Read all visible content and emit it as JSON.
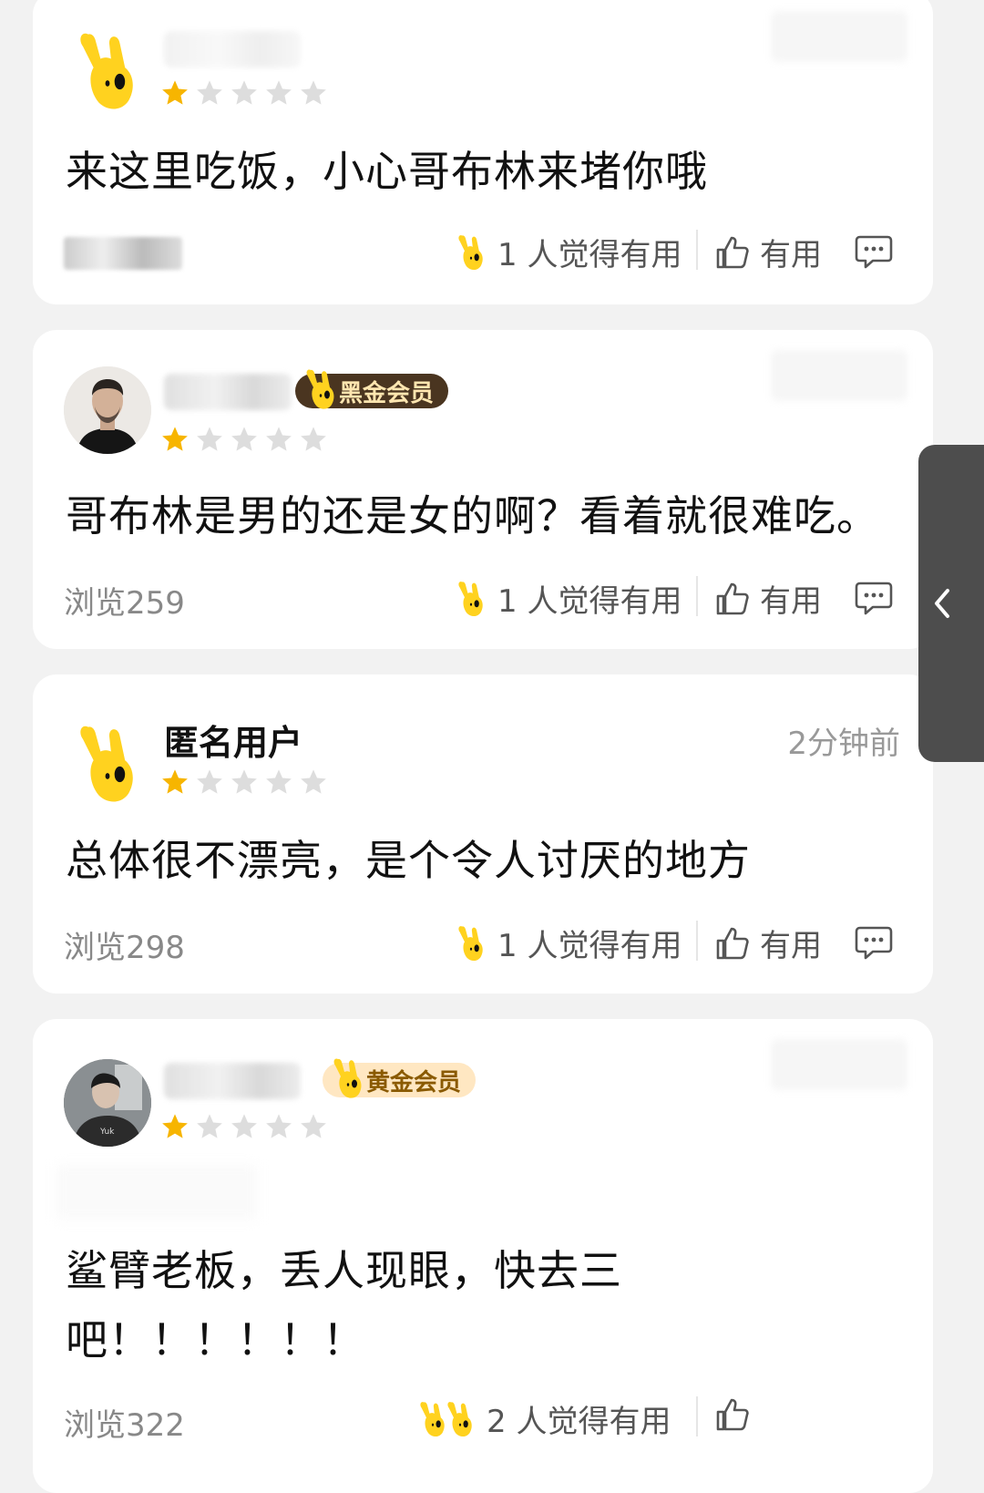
{
  "colors": {
    "star_filled": "#f7b500",
    "star_empty": "#dddddd",
    "mascot": "#ffd21f"
  },
  "reviews": [
    {
      "user_name": "",
      "anonymous": false,
      "time": "",
      "badge": "",
      "rating": 1,
      "text": "来这里吃饭，小心哥布林来堵你哦",
      "views": "",
      "useful_count_text": "1 人觉得有用",
      "useful_label": "有用"
    },
    {
      "user_name": "",
      "time": "",
      "badge": "黑金会员",
      "rating": 1,
      "text": "哥布林是男的还是女的啊？看着就很难吃。",
      "views": "浏览259",
      "useful_count_text": "1 人觉得有用",
      "useful_label": "有用"
    },
    {
      "user_name": "匿名用户",
      "time": "2分钟前",
      "badge": "",
      "rating": 1,
      "text": "总体很不漂亮，是个令人讨厌的地方",
      "views": "浏览298",
      "useful_count_text": "1 人觉得有用",
      "useful_label": "有用"
    },
    {
      "user_name": "",
      "time": "",
      "badge": "黄金会员",
      "rating": 1,
      "text_line1": "鲨臂老板，丢人现眼，快去三",
      "text_line2": "吧！！！！！！",
      "views": "浏览322",
      "useful_count_text": "2 人觉得有用",
      "useful_label": "有用"
    }
  ]
}
